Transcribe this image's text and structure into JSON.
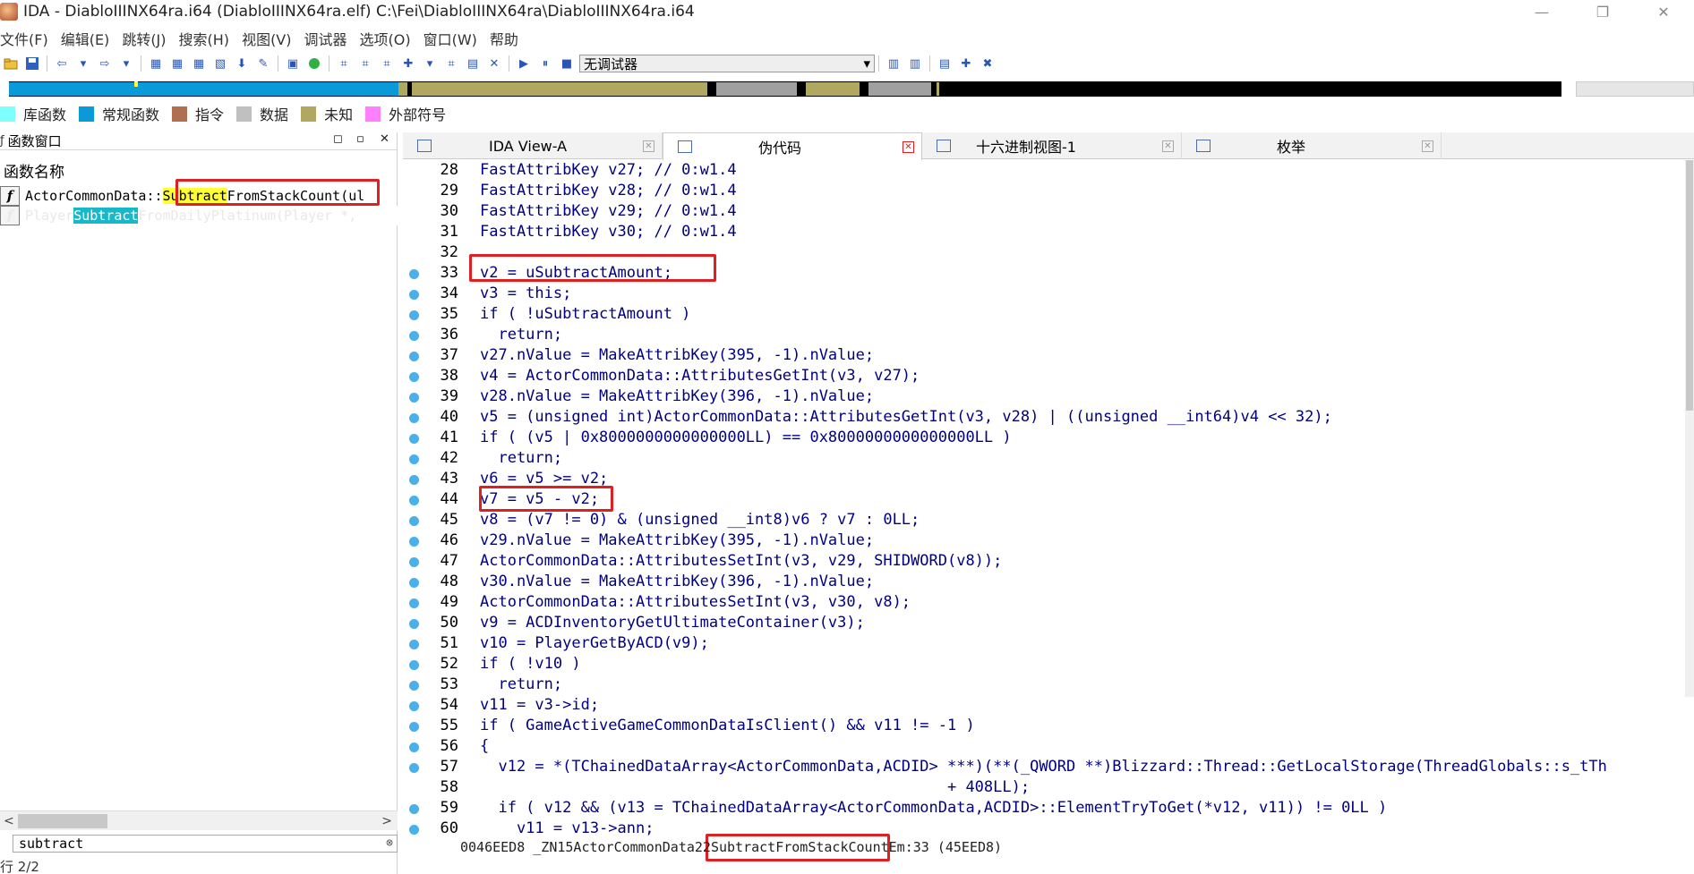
{
  "window": {
    "title": "IDA - DiabloIIINX64ra.i64 (DiabloIIINX64ra.elf) C:\\Fei\\DiabloIIINX64ra\\DiabloIIINX64ra.i64",
    "minimize": "—",
    "restore": "❐",
    "close": "✕"
  },
  "menu": [
    "文件(F)",
    "编辑(E)",
    "跳转(J)",
    "搜索(H)",
    "视图(V)",
    "调试器",
    "选项(O)",
    "窗口(W)",
    "帮助"
  ],
  "toolbar": {
    "debugger_value": "无调试器",
    "debugger_arrow": "▾"
  },
  "legend": [
    {
      "label": "库函数",
      "color": "#80ffff"
    },
    {
      "label": "常规函数",
      "color": "#0a9ad8"
    },
    {
      "label": "指令",
      "color": "#b07050"
    },
    {
      "label": "数据",
      "color": "#c0c0c0"
    },
    {
      "label": "未知",
      "color": "#b0a860"
    },
    {
      "label": "外部符号",
      "color": "#ff80ff"
    }
  ],
  "func_window": {
    "title": "函数窗口",
    "column_header": "函数名称",
    "ctrl_float": "◻",
    "ctrl_restore": "▫",
    "ctrl_close": "✕",
    "rows": [
      {
        "prefix": "ActorCommonData::",
        "match": "Subtract",
        "suffix": "FromStackCount(ul"
      },
      {
        "prefix": "Player",
        "match": "Subtract",
        "suffix": "FromDailyPlatinum(Player *,"
      }
    ],
    "scroll_left": "<",
    "scroll_right": ">",
    "search_value": "subtract",
    "search_clear": "⊗",
    "line_count": "行 2/2"
  },
  "tabs": [
    {
      "label": "IDA View-A",
      "close": "✕"
    },
    {
      "label": "伪代码",
      "close": "✕"
    },
    {
      "label": "十六进制视图-1",
      "close": "✕"
    },
    {
      "label": "枚举",
      "close": "✕"
    }
  ],
  "code_lines": [
    {
      "n": "28",
      "t": "FastAttribKey v27; // 0:w1.4"
    },
    {
      "n": "29",
      "t": "FastAttribKey v28; // 0:w1.4"
    },
    {
      "n": "30",
      "t": "FastAttribKey v29; // 0:w1.4"
    },
    {
      "n": "31",
      "t": "FastAttribKey v30; // 0:w1.4"
    },
    {
      "n": "32",
      "t": ""
    },
    {
      "n": "33",
      "t": "v2 = uSubtractAmount;"
    },
    {
      "n": "34",
      "t": "v3 = this;"
    },
    {
      "n": "35",
      "t": "if ( !uSubtractAmount )"
    },
    {
      "n": "36",
      "t": "  return;"
    },
    {
      "n": "37",
      "t": "v27.nValue = MakeAttribKey(395, -1).nValue;"
    },
    {
      "n": "38",
      "t": "v4 = ActorCommonData::AttributesGetInt(v3, v27);"
    },
    {
      "n": "39",
      "t": "v28.nValue = MakeAttribKey(396, -1).nValue;"
    },
    {
      "n": "40",
      "t": "v5 = (unsigned int)ActorCommonData::AttributesGetInt(v3, v28) | ((unsigned __int64)v4 << 32);"
    },
    {
      "n": "41",
      "t": "if ( (v5 | 0x8000000000000000LL) == 0x8000000000000000LL )"
    },
    {
      "n": "42",
      "t": "  return;"
    },
    {
      "n": "43",
      "t": "v6 = v5 >= v2;"
    },
    {
      "n": "44",
      "t": "v7 = v5 - v2;"
    },
    {
      "n": "45",
      "t": "v8 = (v7 != 0) & (unsigned __int8)v6 ? v7 : 0LL;"
    },
    {
      "n": "46",
      "t": "v29.nValue = MakeAttribKey(395, -1).nValue;"
    },
    {
      "n": "47",
      "t": "ActorCommonData::AttributesSetInt(v3, v29, SHIDWORD(v8));"
    },
    {
      "n": "48",
      "t": "v30.nValue = MakeAttribKey(396, -1).nValue;"
    },
    {
      "n": "49",
      "t": "ActorCommonData::AttributesSetInt(v3, v30, v8);"
    },
    {
      "n": "50",
      "t": "v9 = ACDInventoryGetUltimateContainer(v3);"
    },
    {
      "n": "51",
      "t": "v10 = PlayerGetByACD(v9);"
    },
    {
      "n": "52",
      "t": "if ( !v10 )"
    },
    {
      "n": "53",
      "t": "  return;"
    },
    {
      "n": "54",
      "t": "v11 = v3->id;"
    },
    {
      "n": "55",
      "t": "if ( GameActiveGameCommonDataIsClient() && v11 != -1 )"
    },
    {
      "n": "56",
      "t": "{"
    },
    {
      "n": "57",
      "t": "  v12 = *(TChainedDataArray<ActorCommonData,ACDID> ***)(**(_QWORD **)Blizzard::Thread::GetLocalStorage(ThreadGlobals::s_tTh"
    },
    {
      "n": "58",
      "t": "                                                   + 408LL);"
    },
    {
      "n": "59",
      "t": "  if ( v12 && (v13 = TChainedDataArray<ActorCommonData,ACDID>::ElementTryToGet(*v12, v11)) != 0LL )"
    },
    {
      "n": "60",
      "t": "    v11 = v13->ann;"
    }
  ],
  "status": {
    "prefix": "0046EED8 _ZN15ActorCommonData22",
    "match": "SubtractFromStackCount",
    "suffix": "Em:33 (45EED8)"
  }
}
